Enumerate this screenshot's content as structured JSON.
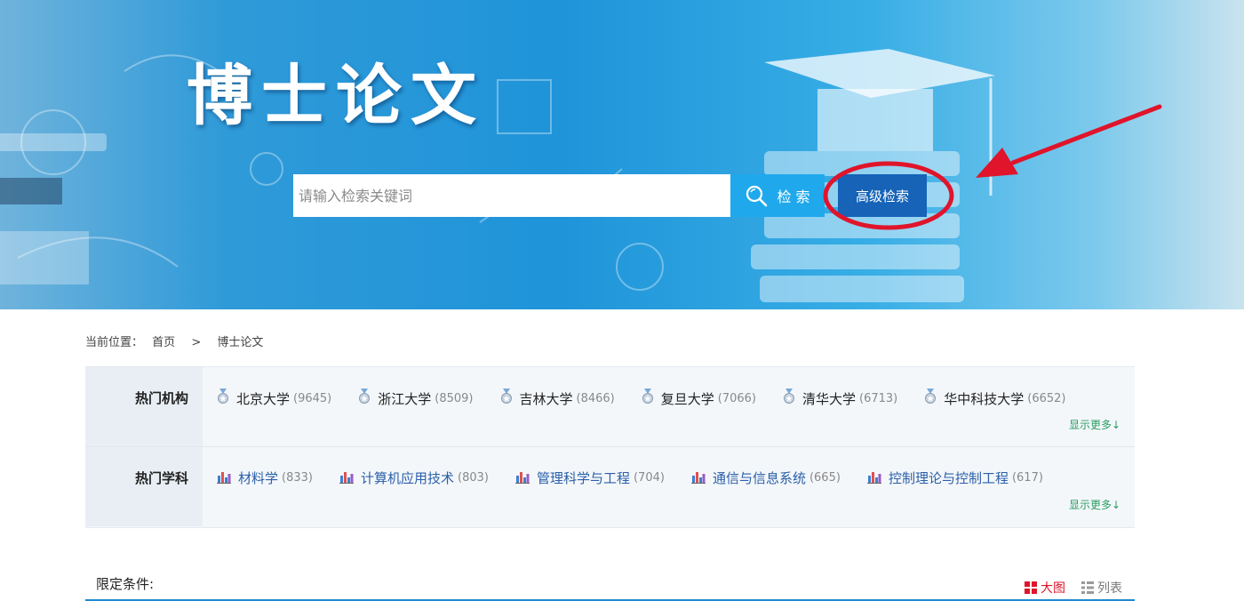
{
  "banner": {
    "title": "博士论文",
    "search_placeholder": "请输入检索关键词",
    "search_button": "检 索",
    "advanced_search_button": "高级检索"
  },
  "breadcrumb": {
    "label": "当前位置：",
    "home": "首页",
    "separator": ">",
    "current": "博士论文"
  },
  "hot_institutions": {
    "label": "热门机构",
    "items": [
      {
        "name": "北京大学",
        "count": "(9645)"
      },
      {
        "name": "浙江大学",
        "count": "(8509)"
      },
      {
        "name": "吉林大学",
        "count": "(8466)"
      },
      {
        "name": "复旦大学",
        "count": "(7066)"
      },
      {
        "name": "清华大学",
        "count": "(6713)"
      },
      {
        "name": "华中科技大学",
        "count": "(6652)"
      }
    ],
    "more": "显示更多↓",
    "icon": "medal-icon"
  },
  "hot_subjects": {
    "label": "热门学科",
    "items": [
      {
        "name": "材料学",
        "count": "(833)"
      },
      {
        "name": "计算机应用技术",
        "count": "(803)"
      },
      {
        "name": "管理科学与工程",
        "count": "(704)"
      },
      {
        "name": "通信与信息系统",
        "count": "(665)"
      },
      {
        "name": "控制理论与控制工程",
        "count": "(617)"
      }
    ],
    "more": "显示更多↓",
    "icon": "bar-chart-icon"
  },
  "limit": {
    "label": "限定条件:",
    "view_grid": "大图",
    "view_list": "列表"
  },
  "colors": {
    "accent": "#1fa9ec",
    "advanced_button": "#1663b8",
    "annotation": "#e0142a",
    "more_link": "#2a9d62",
    "subject_link": "#2a5fa8"
  }
}
